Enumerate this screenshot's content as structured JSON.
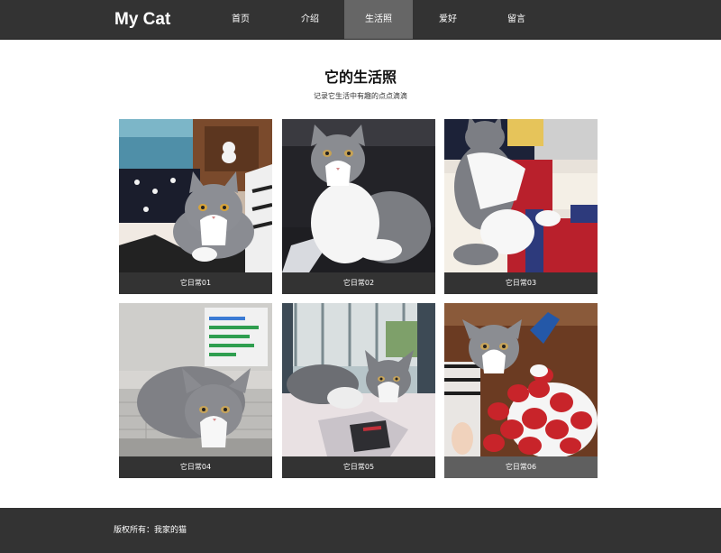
{
  "nav": {
    "brand": "My Cat",
    "items": [
      {
        "label": "首页",
        "active": false
      },
      {
        "label": "介绍",
        "active": false
      },
      {
        "label": "生活照",
        "active": true
      },
      {
        "label": "爱好",
        "active": false
      },
      {
        "label": "留言",
        "active": false
      }
    ]
  },
  "gallery": {
    "title": "它的生活照",
    "subtitle": "记录它生活中有趣的点点滴滴",
    "photos": [
      {
        "caption": "它日常01"
      },
      {
        "caption": "它日常02"
      },
      {
        "caption": "它日常03"
      },
      {
        "caption": "它日常04"
      },
      {
        "caption": "它日常05"
      },
      {
        "caption": "它日常06"
      }
    ]
  },
  "footer": {
    "text": "版权所有：我家的猫"
  },
  "colors": {
    "nav_bg": "#333333",
    "active_nav": "#666666",
    "caption_bg": "#333333",
    "caption_hover": "#5f5f5f"
  }
}
